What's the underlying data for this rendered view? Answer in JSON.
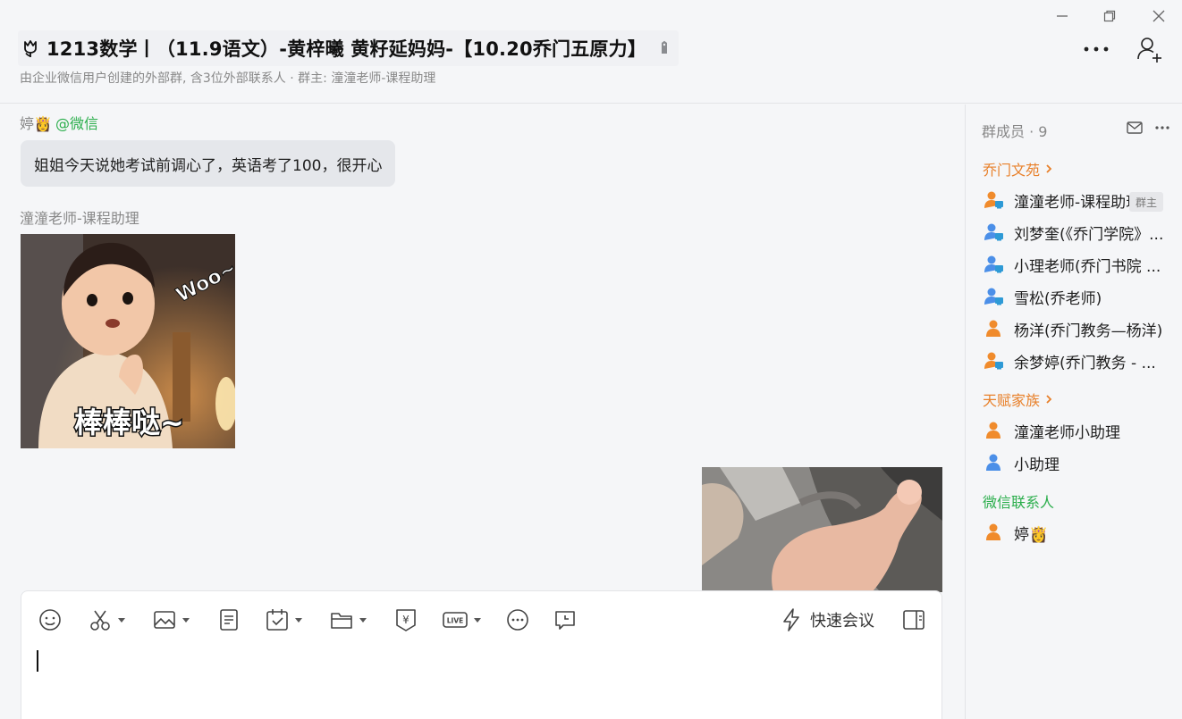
{
  "window": {
    "title": "1213数学丨（11.9语文）-黄梓曦 黄籽延妈妈-【10.20乔门五原力】",
    "subtitle": "由企业微信用户创建的外部群, 含3位外部联系人 · 群主: 潼潼老师-课程助理"
  },
  "messages": [
    {
      "sender": "婷👸",
      "sender_suffix": "@微信",
      "text": "姐姐今天说她考试前调心了，英语考了100，很开心"
    },
    {
      "sender": "潼潼老师-课程助理",
      "sticker_text_top": "Woo~",
      "sticker_text_bottom": "棒棒哒~"
    }
  ],
  "composer": {
    "quick_meeting_label": "快速会议",
    "tools": [
      "emoji-icon",
      "scissors-icon",
      "image-icon",
      "doc-icon",
      "schedule-icon",
      "folder-icon",
      "red-packet-icon",
      "live-icon",
      "more-icon",
      "clock-chat-icon"
    ],
    "live_label": "LIVE",
    "yuan_label": "¥"
  },
  "panel": {
    "header": "群成员 · 9",
    "owner_badge": "群主",
    "groups": [
      {
        "label": "乔门文苑",
        "members": [
          {
            "name": "潼潼老师-课程助理",
            "avatar": "person-orange-screen"
          },
          {
            "name": "刘梦奎(《乔门学院》...",
            "avatar": "person-blue-screen"
          },
          {
            "name": "小理老师(乔门书院 ...",
            "avatar": "person-blue-screen"
          },
          {
            "name": "雪松(乔老师)",
            "avatar": "person-blue-screen"
          },
          {
            "name": "杨洋(乔门教务—杨洋)",
            "avatar": "person-orange"
          },
          {
            "name": "余梦婷(乔门教务 - ...",
            "avatar": "person-orange-screen"
          }
        ]
      },
      {
        "label": "天赋家族",
        "members": [
          {
            "name": "潼潼老师小助理",
            "avatar": "person-orange"
          },
          {
            "name": "小助理",
            "avatar": "person-blue"
          }
        ]
      },
      {
        "label": "微信联系人",
        "members": [
          {
            "name": "婷👸",
            "avatar": "person-orange"
          }
        ]
      }
    ]
  },
  "colors": {
    "accent_orange": "#e8802a",
    "wechat_green": "#2bae4c",
    "member_blue": "#4b8fe8",
    "bubble_gray": "#e5e7eb"
  }
}
